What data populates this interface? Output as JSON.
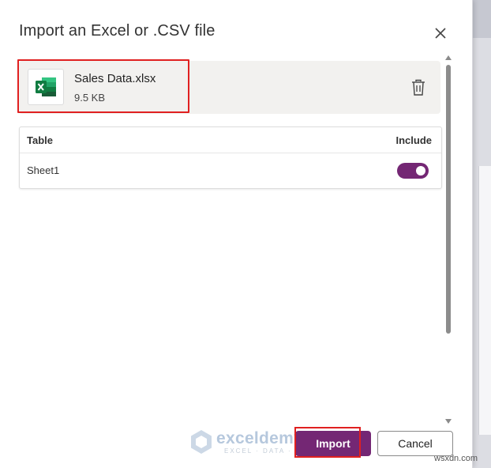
{
  "dialog": {
    "title": "Import an Excel or .CSV file",
    "file": {
      "name": "Sales Data.xlsx",
      "size": "9.5 KB",
      "icon": "excel-file-icon"
    },
    "table": {
      "headers": {
        "table": "Table",
        "include": "Include"
      },
      "rows": [
        {
          "name": "Sheet1",
          "include": true
        }
      ]
    },
    "buttons": {
      "import": "Import",
      "cancel": "Cancel"
    }
  },
  "watermark": {
    "name": "exceldemy",
    "tagline": "EXCEL · DATA · BI"
  },
  "corner_mark": "wsxdn.com",
  "colors": {
    "accent": "#742774",
    "highlight": "#e02020"
  }
}
